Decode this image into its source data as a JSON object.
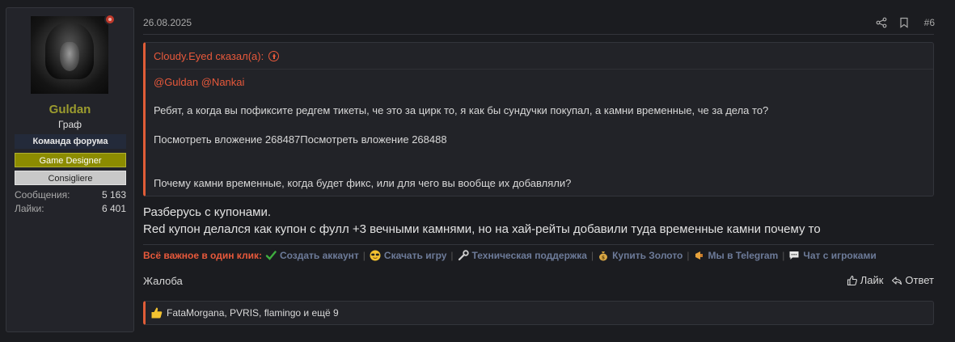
{
  "user": {
    "name": "Guldan",
    "title": "Граф",
    "banners": [
      "Команда форума",
      "Game Designer",
      "Consigliere"
    ],
    "stats": [
      {
        "label": "Сообщения:",
        "value": "5 163"
      },
      {
        "label": "Лайки:",
        "value": "6 401"
      }
    ]
  },
  "post": {
    "date": "26.08.2025",
    "number": "#6"
  },
  "quote": {
    "author": "Cloudy.Eyed сказал(а):",
    "mentions": "@Guldan @Nankai",
    "line1": "Ребят, а когда вы пофиксите редгем тикеты, че это за цирк то, я как бы сундучки покупал, а камни временные, че за дела то?",
    "line2": "Посмотреть вложение 268487Посмотреть вложение 268488",
    "line3": "Почему камни временные, когда будет фикс, или для чего вы вообще их добавляли?"
  },
  "body": {
    "line1": "Разберусь с купонами.",
    "line2": "Red купон делался как купон с фулл +3 вечными камнями, но на хай-рейты добавили туда временные камни почему то"
  },
  "promo": {
    "lead": "Всё важное в один клик:",
    "links": [
      "Создать аккаунт",
      "Скачать игру",
      "Техническая поддержка",
      "Купить Золото",
      "Мы в Telegram",
      "Чат с игроками"
    ],
    "separator": "|"
  },
  "footer": {
    "report": "Жалоба",
    "like": "Лайк",
    "reply": "Ответ"
  },
  "likes": {
    "text": "FataMorgana, PVRIS, flamingo и ещё 9"
  },
  "colors": {
    "accent": "#e8593b",
    "username": "#9b9b2e",
    "link": "#6d7b99",
    "background": "#1b1c20"
  }
}
